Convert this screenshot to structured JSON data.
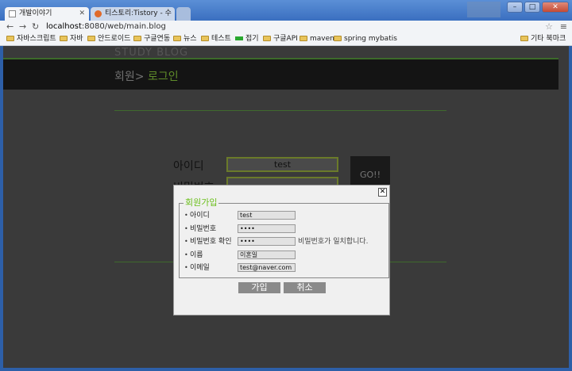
{
  "browser": {
    "tabs": [
      {
        "title": "개발이야기",
        "active": true
      },
      {
        "title": "티스토리:Tistory - 수",
        "active": false
      }
    ],
    "address": {
      "host": "localhost",
      "rest": ":8080/web/main.blog"
    },
    "bookmarks": [
      "자바스크립트",
      "자바",
      "안드로이드",
      "구글연동",
      "뉴스",
      "테스트",
      "접기",
      "구글API",
      "maven",
      "spring mybatis"
    ],
    "other_bookmarks": "기타 북마크"
  },
  "page": {
    "site_title": "STUDY BLOG",
    "breadcrumb": {
      "parent": "회원>",
      "current": " 로그인"
    },
    "login": {
      "id_label": "아이디",
      "pw_label": "비밀번호",
      "id_value": "test",
      "go_label": "GO!!"
    }
  },
  "modal": {
    "close": "✕",
    "legend": "회원가입",
    "fields": [
      {
        "label": "아이디",
        "value": "test"
      },
      {
        "label": "비밀번호",
        "value": "••••"
      },
      {
        "label": "비밀번호 확인",
        "value": "••••",
        "hint": "비밀번호가 일치합니다."
      },
      {
        "label": "이름",
        "value": "이혼일"
      },
      {
        "label": "이메일",
        "value": "test@naver.com"
      }
    ],
    "join_label": "가입",
    "cancel_label": "취소"
  },
  "colors": {
    "accent_green": "#6bbf1b",
    "modal_bg": "#f0f0f0",
    "page_dim": "#3a3a3a"
  }
}
